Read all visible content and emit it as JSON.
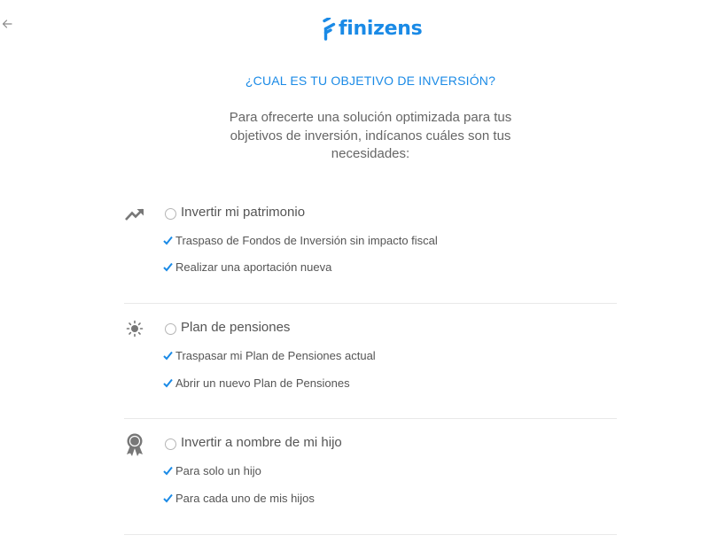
{
  "header": {
    "back_icon": "arrow-left-icon",
    "logo_text": "finizens",
    "logo_mark": "finizens-logo-mark"
  },
  "page": {
    "title": "¿CUAL ES TU OBJETIVO DE INVERSIÓN?",
    "intro": "Para ofrecerte una solución optimizada para tus objetivos de inversión, indícanos cuáles son tus necesidades:"
  },
  "options": [
    {
      "icon": "trending-up-icon",
      "label": "Invertir mi patrimonio",
      "features": [
        "Traspaso de Fondos de Inversión sin impacto fiscal",
        "Realizar una aportación nueva"
      ]
    },
    {
      "icon": "sun-icon",
      "label": "Plan de pensiones",
      "features": [
        "Traspasar mi Plan de Pensiones actual",
        "Abrir un nuevo Plan de Pensiones"
      ]
    },
    {
      "icon": "award-ribbon-icon",
      "label": "Invertir a nombre de mi hijo",
      "features": [
        "Para solo un hijo",
        "Para cada uno de mis hijos"
      ]
    }
  ],
  "colors": {
    "brand": "#1a8ae6",
    "text": "#666666",
    "icon": "#777777",
    "divider": "#e9e9e9"
  }
}
